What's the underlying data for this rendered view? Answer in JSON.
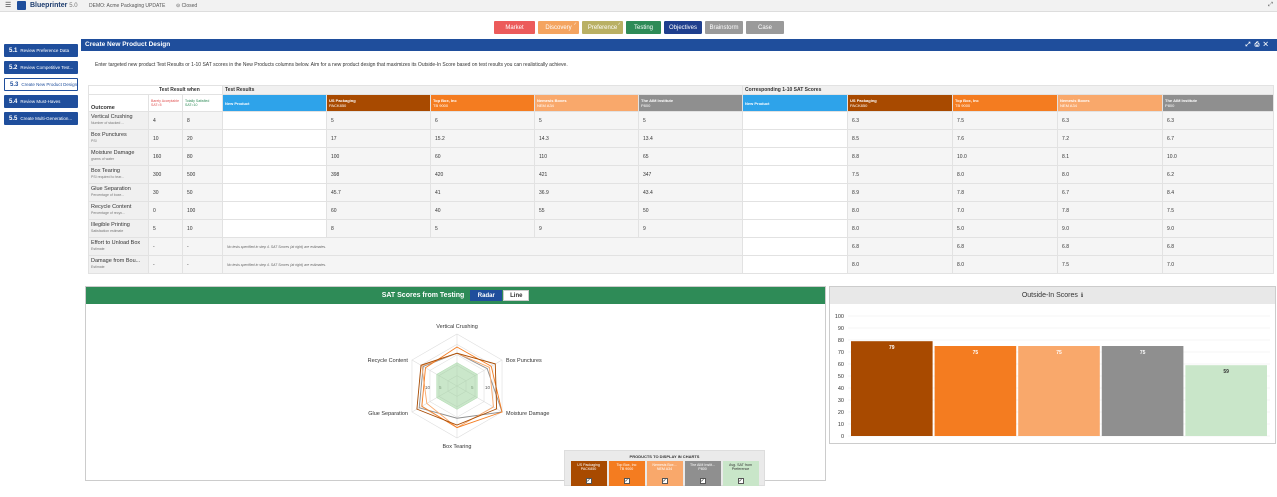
{
  "topbar": {
    "brand": "Blueprinter",
    "version": "5.0",
    "demo": "DEMO: Acme Packaging UPDATE",
    "status": "Closed"
  },
  "stages": [
    {
      "label": "Market",
      "color": "#ec5b5b",
      "width": 41
    },
    {
      "label": "Discovery",
      "color": "#f4a460",
      "width": 41,
      "sup": "✓"
    },
    {
      "label": "Preference",
      "color": "#b9b064",
      "width": 41,
      "sup": "✓"
    },
    {
      "label": "Testing",
      "color": "#2e8b57",
      "width": 35
    },
    {
      "label": "Objectives",
      "color": "#1f3f8e",
      "width": 38
    },
    {
      "label": "Brainstorm",
      "color": "#9a9a9a",
      "width": 38
    },
    {
      "label": "Case",
      "color": "#9a9a9a",
      "width": 38
    }
  ],
  "sidebar": [
    {
      "num": "5.1",
      "label": "Review Preference Data",
      "active": false
    },
    {
      "num": "5.2",
      "label": "Review Competitive Test...",
      "active": false
    },
    {
      "num": "5.3",
      "label": "Create New Product Design",
      "active": true
    },
    {
      "num": "5.4",
      "label": "Review Must-Haves",
      "active": false
    },
    {
      "num": "5.5",
      "label": "Create Multi-Generation...",
      "active": false
    }
  ],
  "panel": {
    "title": "Create New Product Design",
    "instructions": "Enter targeted new product Test Results or 1-10 SAT scores in the New Products columns below. Aim for a new product design that maximizes its Outside-In Score based on test results you can realistically achieve."
  },
  "table": {
    "h_when": "Test Result when",
    "h_results": "Test Results",
    "h_sat": "Corresponding 1-10 SAT Scores",
    "h_outcome": "Outcome",
    "h_barely": "Barely Acceptable SAT=5",
    "h_totally": "Totally Satisfied SAT=10",
    "new_product": "New Product",
    "products": [
      {
        "name": "US Packaging",
        "model": "PACK850",
        "color": "#a84a00"
      },
      {
        "name": "Top Box, Inc",
        "model": "TB 9000",
        "color": "#f47c20"
      },
      {
        "name": "Nemesis Boxes",
        "model": "NEM A34",
        "color": "#f9a86b"
      },
      {
        "name": "The AIM Institute",
        "model": "P800",
        "color": "#8f8f8f"
      }
    ],
    "na_note": "No tests specified in step 4. SAT Scores (at right) are estimates.",
    "rows": [
      {
        "outcome": "Vertical Crushing",
        "sub": "Number of stacked ...",
        "barely": "4",
        "totally": "8",
        "results": [
          "5",
          "6",
          "5",
          "5"
        ],
        "sat": [
          "6.3",
          "7.5",
          "6.3",
          "6.3"
        ]
      },
      {
        "outcome": "Box Punctures",
        "sub": "PSI",
        "barely": "10",
        "totally": "20",
        "results": [
          "17",
          "15.2",
          "14.3",
          "13.4"
        ],
        "sat": [
          "8.5",
          "7.6",
          "7.2",
          "6.7"
        ]
      },
      {
        "outcome": "Moisture Damage",
        "sub": "grams of water",
        "barely": "160",
        "totally": "80",
        "results": [
          "100",
          "60",
          "110",
          "65"
        ],
        "sat": [
          "8.8",
          "10.0",
          "8.1",
          "10.0"
        ]
      },
      {
        "outcome": "Box Tearing",
        "sub": "PSI required to tear...",
        "barely": "300",
        "totally": "500",
        "results": [
          "398",
          "420",
          "421",
          "347"
        ],
        "sat": [
          "7.5",
          "8.0",
          "8.0",
          "6.2"
        ]
      },
      {
        "outcome": "Glue Separation",
        "sub": "Percentage of boxe...",
        "barely": "30",
        "totally": "50",
        "results": [
          "45.7",
          "41",
          "36.9",
          "43.4"
        ],
        "sat": [
          "8.9",
          "7.8",
          "6.7",
          "8.4"
        ]
      },
      {
        "outcome": "Recycle Content",
        "sub": "Percentage of recyc...",
        "barely": "0",
        "totally": "100",
        "results": [
          "60",
          "40",
          "55",
          "50"
        ],
        "sat": [
          "8.0",
          "7.0",
          "7.8",
          "7.5"
        ]
      },
      {
        "outcome": "Illegible Printing",
        "sub": "Satisfaction estimate",
        "barely": "5",
        "totally": "10",
        "results": [
          "8",
          "5",
          "9",
          "9"
        ],
        "sat": [
          "8.0",
          "5.0",
          "9.0",
          "9.0"
        ]
      },
      {
        "outcome": "Effort to Unload Box",
        "sub": "Estimate",
        "barely": "-",
        "totally": "-",
        "results": null,
        "sat": [
          "6.8",
          "6.8",
          "6.8",
          "6.8"
        ]
      },
      {
        "outcome": "Damage from Bou...",
        "sub": "Estimate",
        "barely": "-",
        "totally": "-",
        "results": null,
        "sat": [
          "8.0",
          "8.0",
          "7.5",
          "7.0"
        ]
      }
    ]
  },
  "radar": {
    "title": "SAT Scores from Testing",
    "tab_radar": "Radar",
    "tab_line": "Line",
    "axes": [
      "Vertical Crushing",
      "Box Punctures",
      "Moisture Damage",
      "Box Tearing",
      "Glue Separation",
      "Recycle Content"
    ],
    "ring_labels": [
      "5",
      "10"
    ]
  },
  "legend": {
    "title": "PRODUCTS TO DISPLAY IN CHARTS",
    "items": [
      {
        "name": "US Packaging",
        "model": "PACK850",
        "color": "#a84a00",
        "checked": true
      },
      {
        "name": "Top Box, Inc",
        "model": "TB 9000",
        "color": "#f47c20",
        "checked": true
      },
      {
        "name": "Nemesis Box...",
        "model": "NEM A34",
        "color": "#f9a86b",
        "checked": true
      },
      {
        "name": "The AIM Instit...",
        "model": "P800",
        "color": "#8f8f8f",
        "checked": true
      },
      {
        "name": "Avg. SAT from",
        "model": "Preference",
        "color": "#c9e6c9",
        "checked": true,
        "dark": true
      }
    ]
  },
  "outside_in": {
    "title": "Outside-In Scores",
    "info_icon": "info-icon"
  },
  "chart_data": [
    {
      "type": "bar",
      "title": "Outside-In Scores",
      "categories": [
        "US Packaging PACK850",
        "Top Box, Inc TB 9000",
        "Nemesis Boxes NEM A34",
        "The AIM Institute P800",
        "Avg. SAT from Preference"
      ],
      "values": [
        79,
        75,
        75,
        75,
        59
      ],
      "colors": [
        "#a84a00",
        "#f47c20",
        "#f9a86b",
        "#8f8f8f",
        "#c9e6c9"
      ],
      "ylim": [
        0,
        100
      ],
      "yticks": [
        0,
        10,
        20,
        30,
        40,
        50,
        60,
        70,
        80,
        90,
        100
      ]
    },
    {
      "type": "radar",
      "title": "SAT Scores from Testing",
      "axes": [
        "Vertical Crushing",
        "Box Punctures",
        "Moisture Damage",
        "Box Tearing",
        "Glue Separation",
        "Recycle Content"
      ],
      "range": [
        0,
        10
      ],
      "series": [
        {
          "name": "US Packaging PACK850",
          "color": "#a84a00",
          "values": [
            6.3,
            8.5,
            8.8,
            7.5,
            8.9,
            8.0
          ]
        },
        {
          "name": "Top Box, Inc TB 9000",
          "color": "#f47c20",
          "values": [
            7.5,
            7.6,
            10.0,
            8.0,
            7.8,
            7.0
          ]
        },
        {
          "name": "Nemesis Boxes NEM A34",
          "color": "#f9a86b",
          "values": [
            6.3,
            7.2,
            8.1,
            8.0,
            6.7,
            7.8
          ]
        },
        {
          "name": "The AIM Institute P800",
          "color": "#8f8f8f",
          "values": [
            6.3,
            6.7,
            10.0,
            6.2,
            8.4,
            7.5
          ]
        },
        {
          "name": "Avg. SAT from Preference",
          "color": "#9fd49f",
          "values": [
            4.5,
            4.5,
            4.5,
            4.5,
            4.5,
            4.5
          ]
        }
      ]
    }
  ]
}
